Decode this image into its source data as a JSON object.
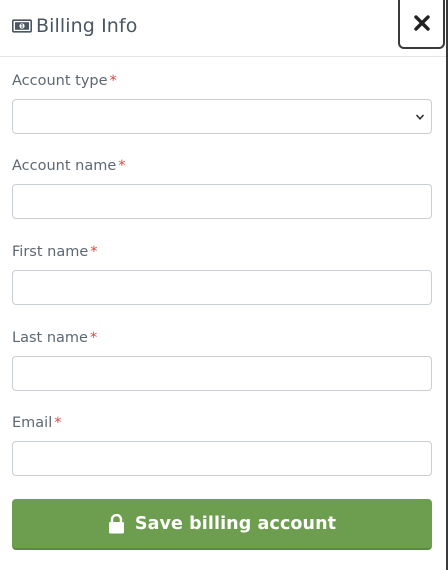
{
  "header": {
    "icon": "money-bill-icon",
    "title": "Billing Info",
    "close_icon": "close-icon"
  },
  "form": {
    "required_marker": "*",
    "fields": [
      {
        "label": "Account type",
        "type": "select",
        "value": ""
      },
      {
        "label": "Account name",
        "type": "text",
        "value": ""
      },
      {
        "label": "First name",
        "type": "text",
        "value": ""
      },
      {
        "label": "Last name",
        "type": "text",
        "value": ""
      },
      {
        "label": "Email",
        "type": "text",
        "value": ""
      }
    ]
  },
  "save_button": {
    "icon": "lock-icon",
    "label": "Save billing account",
    "color": "#6d9e4f"
  },
  "colors": {
    "required": "#e0443f",
    "border": "#c9ced3",
    "text": "#5d6872"
  }
}
